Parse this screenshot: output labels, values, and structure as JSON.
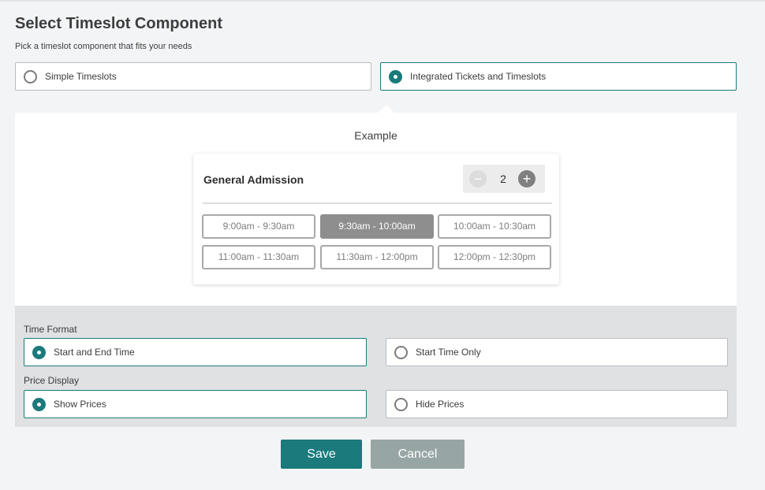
{
  "header": {
    "title": "Select Timeslot Component",
    "subtitle": "Pick a timeslot component that fits your needs"
  },
  "component_options": [
    {
      "label": "Simple Timeslots",
      "selected": false
    },
    {
      "label": "Integrated Tickets and Timeslots",
      "selected": true
    }
  ],
  "example": {
    "label": "Example",
    "ticket_name": "General Admission",
    "quantity": "2",
    "minus_symbol": "−",
    "plus_symbol": "+",
    "timeslots": [
      {
        "label": "9:00am - 9:30am",
        "active": false
      },
      {
        "label": "9:30am - 10:00am",
        "active": true
      },
      {
        "label": "10:00am - 10:30am",
        "active": false
      },
      {
        "label": "11:00am - 11:30am",
        "active": false
      },
      {
        "label": "11:30am - 12:00pm",
        "active": false
      },
      {
        "label": "12:00pm - 12:30pm",
        "active": false
      }
    ]
  },
  "time_format": {
    "label": "Time Format",
    "options": [
      {
        "label": "Start and End Time",
        "selected": true
      },
      {
        "label": "Start Time Only",
        "selected": false
      }
    ]
  },
  "price_display": {
    "label": "Price Display",
    "options": [
      {
        "label": "Show Prices",
        "selected": true
      },
      {
        "label": "Hide Prices",
        "selected": false
      }
    ]
  },
  "actions": {
    "save_label": "Save",
    "cancel_label": "Cancel"
  },
  "colors": {
    "accent": "#1a7a7c",
    "cancel": "#97a5a5",
    "active_slot": "#8e8e8e"
  }
}
